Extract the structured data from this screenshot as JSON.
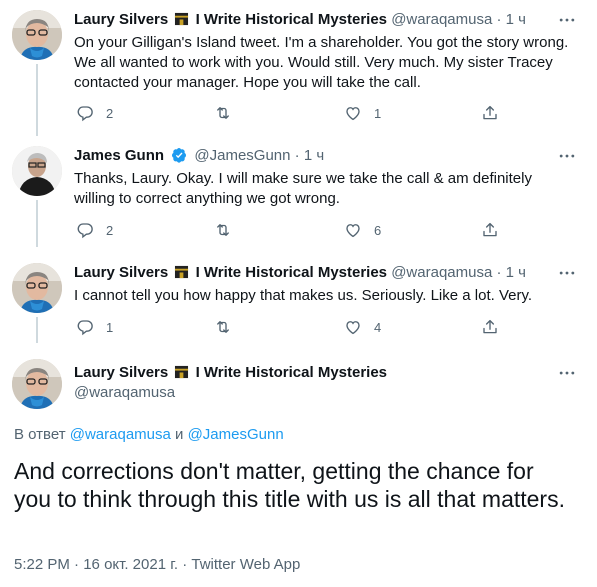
{
  "tweets": [
    {
      "name": "Laury Silvers",
      "title": "I Write Historical Mysteries",
      "handle": "@waraqamusa",
      "dot": "·",
      "time": "1 ч",
      "text": "On your Gilligan's Island tweet. I'm a shareholder. You got the story wrong. We all wanted to work with you. Would still. Very much. My sister Tracey contacted your manager. Hope you will take the call.",
      "replies": "2",
      "retweets": "",
      "likes": "1"
    },
    {
      "name": "James Gunn",
      "handle": "@JamesGunn",
      "dot": "·",
      "time": "1 ч",
      "text": "Thanks, Laury. Okay. I will make sure we take the call & am definitely willing to correct anything we got wrong.",
      "replies": "2",
      "retweets": "",
      "likes": "6"
    },
    {
      "name": "Laury Silvers",
      "title": "I Write Historical Mysteries",
      "handle": "@waraqamusa",
      "dot": "·",
      "time": "1 ч",
      "text": "I cannot tell you how happy that makes us. Seriously. Like a lot. Very.",
      "replies": "1",
      "retweets": "",
      "likes": "4"
    }
  ],
  "main": {
    "name": "Laury Silvers",
    "title": "I Write Historical Mysteries",
    "handle": "@waraqamusa",
    "reply_prefix": "В ответ ",
    "reply_user1": "@waraqamusa",
    "reply_and": " и ",
    "reply_user2": "@JamesGunn",
    "text": "And corrections don't matter, getting the chance for you to think through this title with us is all that matters.",
    "time": "5:22 PM",
    "dot": " · ",
    "date": "16 окт. 2021 г.",
    "source": "Twitter Web App"
  },
  "colors": {
    "text": "#0f1419",
    "secondary": "#536471",
    "link": "#1d9bf0",
    "verified": "#1d9bf0",
    "separator": "#eff3f4"
  }
}
